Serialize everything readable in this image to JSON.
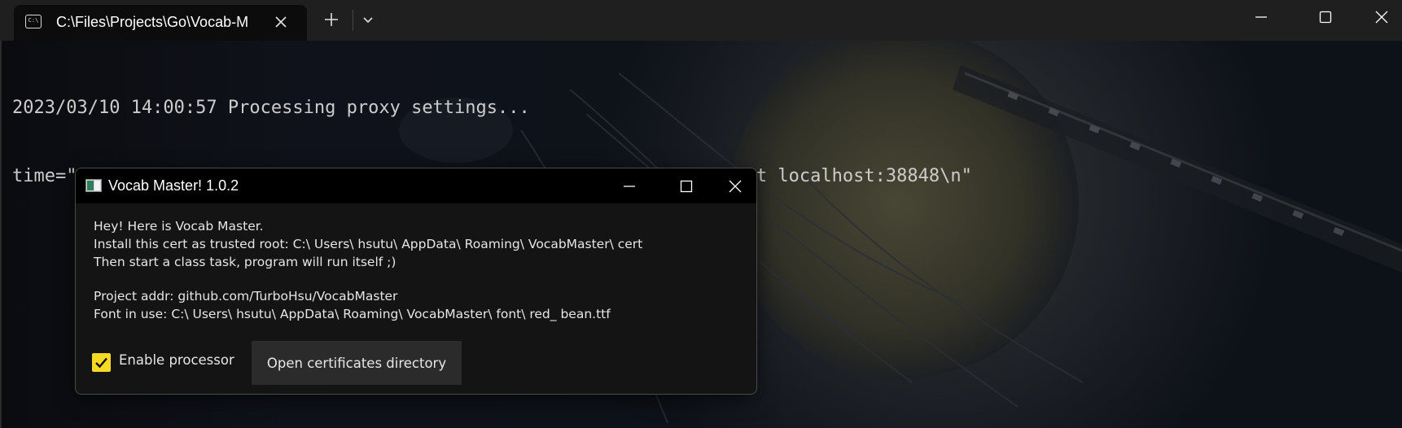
{
  "terminal": {
    "tab_title": "C:\\Files\\Projects\\Go\\Vocab-M",
    "lines": [
      "2023/03/10 14:00:57 Processing proxy settings...",
      "time=\"2023-03-10T14:00:58+08:00\" level=info msg=\"Proxy start listen at localhost:38848\\n\""
    ]
  },
  "dialog": {
    "title": "Vocab Master! 1.0.2",
    "body": {
      "line1": "Hey! Here is Vocab Master.",
      "line2": "Install this cert as trusted root: C:\\ Users\\ hsutu\\ AppData\\ Roaming\\ VocabMaster\\ cert",
      "line3": "Then start a class task, program will run itself ;)",
      "line4": "Project addr: github.com/TurboHsu/VocabMaster",
      "line5": "Font in use: C:\\ Users\\ hsutu\\ AppData\\ Roaming\\ VocabMaster\\ font\\ red_ bean.ttf"
    },
    "checkbox_label": "Enable processor",
    "checkbox_checked": true,
    "open_button_label": "Open certificates directory"
  },
  "icons": {
    "terminal_tab": "terminal-icon",
    "close_tab": "close-icon",
    "new_tab": "plus-icon",
    "tab_dropdown": "chevron-down-icon",
    "minimize": "minimize-icon",
    "maximize": "maximize-icon",
    "close_window": "close-icon",
    "checkmark": "checkmark-icon"
  },
  "colors": {
    "checkbox_accent": "#f5d925",
    "terminal_background": "#0b0c10",
    "terminal_text": "#cccccc"
  }
}
